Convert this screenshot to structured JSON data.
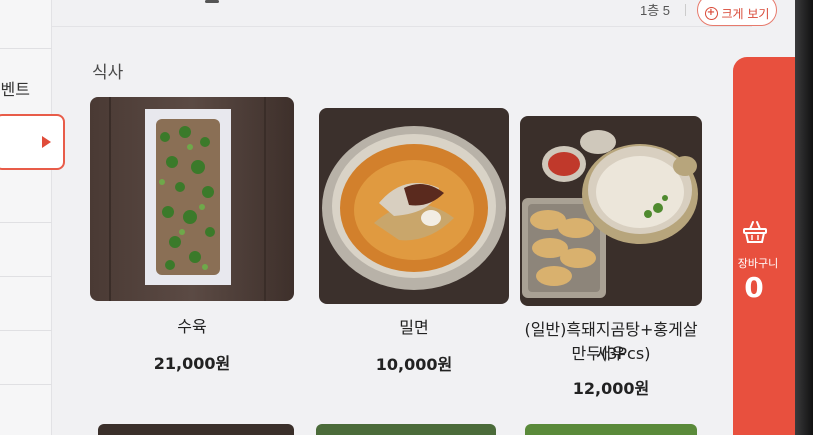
{
  "sidebar": {
    "event_label": "벤트"
  },
  "header": {
    "floor": "1층 5",
    "zoom_label": "크게 보기"
  },
  "section": {
    "title": "식사"
  },
  "products": [
    {
      "name": "수육",
      "price": "21,000원"
    },
    {
      "name": "밀면",
      "price": "10,000원"
    },
    {
      "name_line1": "(일반)흑돼지곰탕+홍게살 새우",
      "name_line2": "만두(3Pcs)",
      "price": "12,000원"
    }
  ],
  "cart": {
    "label": "장바구니",
    "count": "0"
  },
  "colors": {
    "accent": "#e8503e",
    "background": "#f1f1f3"
  },
  "icons": {
    "zoom": "plus-circle-icon",
    "cart": "basket-icon",
    "active_arrow": "triangle-right-icon"
  }
}
